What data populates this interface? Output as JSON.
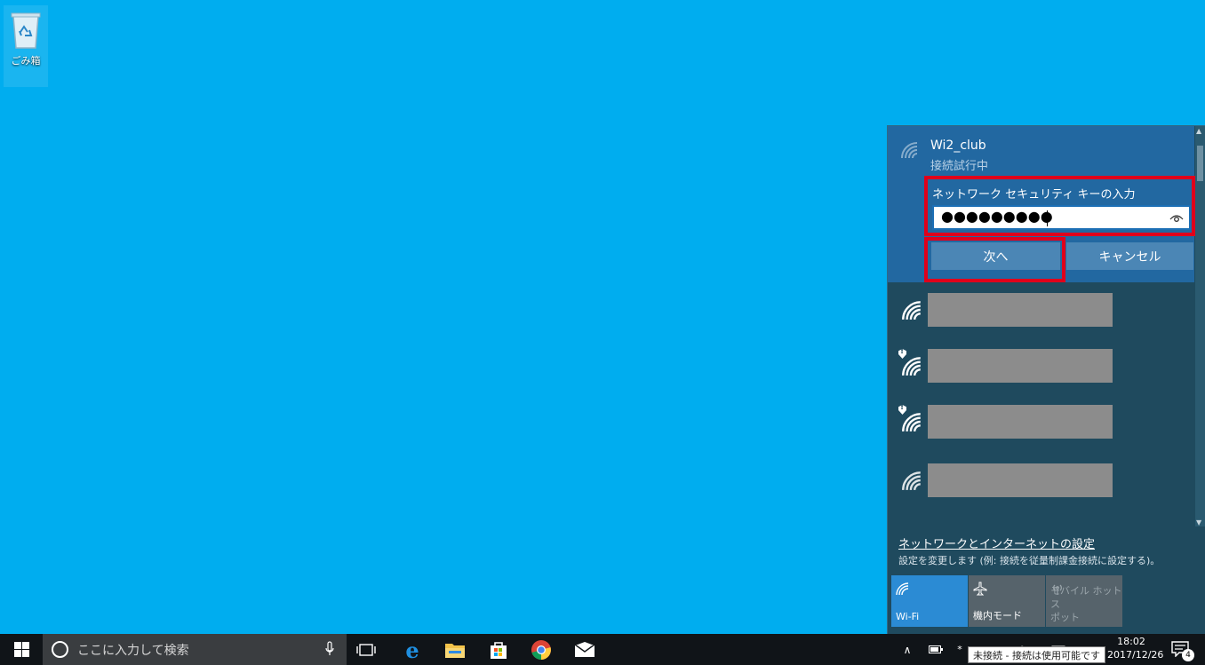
{
  "desktop": {
    "recycle_bin_label": "ごみ箱"
  },
  "flyout": {
    "active_network": {
      "ssid": "Wi2_club",
      "status": "接続試行中",
      "key_label": "ネットワーク セキュリティ キーの入力",
      "key_value": "●●●●●●●●●",
      "next_label": "次へ",
      "cancel_label": "キャンセル"
    },
    "networks": [
      {
        "icon": "wifi-icon",
        "secured": false
      },
      {
        "icon": "wifi-warning-icon",
        "secured": true
      },
      {
        "icon": "wifi-warning-icon",
        "secured": true
      },
      {
        "icon": "wifi-icon",
        "secured": false
      }
    ],
    "settings_link": "ネットワークとインターネットの設定",
    "settings_desc": "設定を変更します (例: 接続を従量制課金接続に設定する)。",
    "tiles": {
      "wifi": "Wi-Fi",
      "airplane": "機内モード",
      "hotspot_line1": "モバイル ホットス",
      "hotspot_line2": "ポット"
    }
  },
  "taskbar": {
    "search_placeholder": "ここに入力して検索",
    "time": "18:02",
    "date": "2017/12/26",
    "tooltip": "未接続 - 接続は使用可能です",
    "notification_count": "4"
  },
  "colors": {
    "desktop": "#00adef",
    "flyout_bg": "#1f4a5e",
    "active_bg": "#2268a1",
    "highlight": "#e0001b",
    "accent": "#2b8bd4"
  }
}
